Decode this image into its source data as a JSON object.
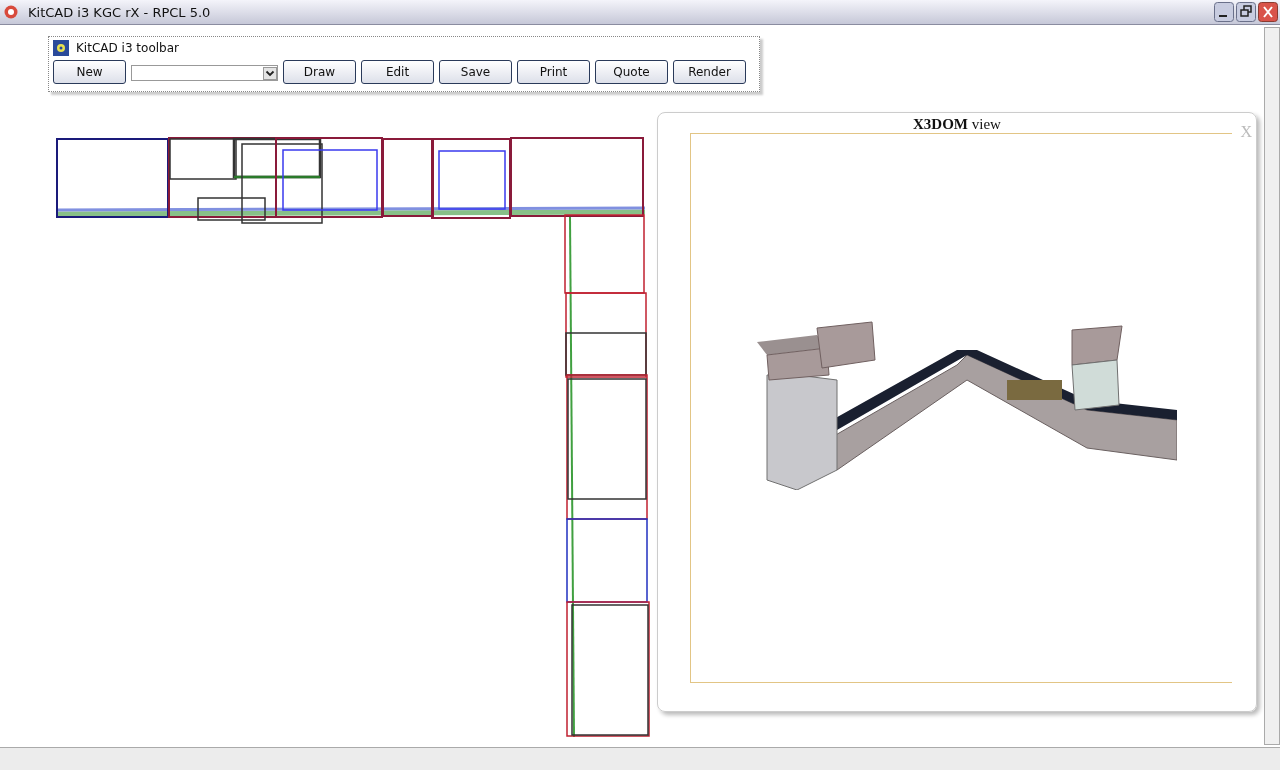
{
  "window": {
    "title": "KitCAD i3 KGC rX - RPCL 5.0"
  },
  "toolbar": {
    "title": "KitCAD i3 toolbar",
    "items": [
      {
        "kind": "button",
        "label": "New"
      },
      {
        "kind": "select"
      },
      {
        "kind": "button",
        "label": "Draw"
      },
      {
        "kind": "button",
        "label": "Edit"
      },
      {
        "kind": "button",
        "label": "Save"
      },
      {
        "kind": "button",
        "label": "Print"
      },
      {
        "kind": "button",
        "label": "Quote"
      },
      {
        "kind": "button",
        "label": "Render"
      }
    ]
  },
  "view_panel": {
    "title": "**X3DOM** view",
    "close": "X"
  }
}
